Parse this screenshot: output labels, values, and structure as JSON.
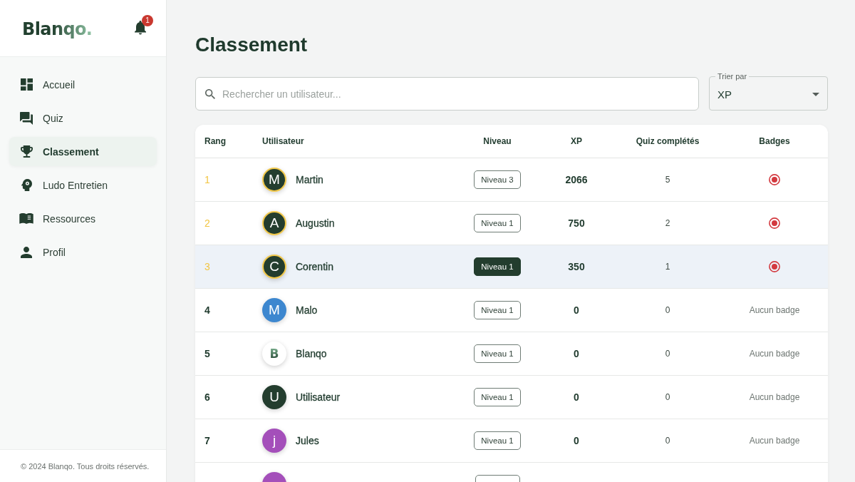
{
  "sidebar": {
    "logo": "Blanqo.",
    "notifications": {
      "count": "1"
    },
    "nav": [
      {
        "label": "Accueil",
        "selected": false
      },
      {
        "label": "Quiz",
        "selected": false
      },
      {
        "label": "Classement",
        "selected": true
      },
      {
        "label": "Ludo Entretien",
        "selected": false
      },
      {
        "label": "Ressources",
        "selected": false
      },
      {
        "label": "Profil",
        "selected": false
      }
    ],
    "footer": "© 2024 Blanqo. Tous droits réservés."
  },
  "page": {
    "title": "Classement"
  },
  "search": {
    "placeholder": "Rechercher un utilisateur..."
  },
  "sort": {
    "label": "Trier par",
    "value": "XP"
  },
  "table": {
    "columns": [
      "Rang",
      "Utilisateur",
      "Niveau",
      "XP",
      "Quiz complétés",
      "Badges"
    ],
    "rows": [
      {
        "kind": "full",
        "rank": "1",
        "podium": true,
        "current_user": false,
        "avatar": {
          "kind": "initial",
          "letter": "M",
          "color": "#233d2e"
        },
        "name": "Martin",
        "level": "Niveau 3",
        "xp": "2066",
        "quizzes": "5",
        "badge": {
          "kind": "icon"
        }
      },
      {
        "kind": "full",
        "rank": "2",
        "podium": true,
        "current_user": false,
        "avatar": {
          "kind": "initial",
          "letter": "A",
          "color": "#233d2e"
        },
        "name": "Augustin",
        "level": "Niveau 1",
        "xp": "750",
        "quizzes": "2",
        "badge": {
          "kind": "icon"
        }
      },
      {
        "kind": "full",
        "rank": "3",
        "podium": true,
        "current_user": true,
        "avatar": {
          "kind": "initial",
          "letter": "C",
          "color": "#233d2e"
        },
        "name": "Corentin",
        "level": "Niveau 1",
        "xp": "350",
        "quizzes": "1",
        "badge": {
          "kind": "icon"
        }
      },
      {
        "kind": "full",
        "rank": "4",
        "podium": false,
        "current_user": false,
        "avatar": {
          "kind": "initial",
          "letter": "M",
          "color": "#3d87cf"
        },
        "name": "Malo",
        "level": "Niveau 1",
        "xp": "0",
        "quizzes": "0",
        "badge": {
          "kind": "none",
          "label": "Aucun badge"
        }
      },
      {
        "kind": "full",
        "rank": "5",
        "podium": false,
        "current_user": false,
        "avatar": {
          "kind": "logo",
          "letter": "B",
          "color": "#ffffff"
        },
        "name": "Blanqo",
        "level": "Niveau 1",
        "xp": "0",
        "quizzes": "0",
        "badge": {
          "kind": "none",
          "label": "Aucun badge"
        }
      },
      {
        "kind": "full",
        "rank": "6",
        "podium": false,
        "current_user": false,
        "avatar": {
          "kind": "initial",
          "letter": "U",
          "color": "#233d2e"
        },
        "name": "Utilisateur",
        "level": "Niveau 1",
        "xp": "0",
        "quizzes": "0",
        "badge": {
          "kind": "none",
          "label": "Aucun badge"
        }
      },
      {
        "kind": "full",
        "rank": "7",
        "podium": false,
        "current_user": false,
        "avatar": {
          "kind": "initial",
          "letter": "j",
          "color": "#a44fba"
        },
        "name": "Jules",
        "level": "Niveau 1",
        "xp": "0",
        "quizzes": "0",
        "badge": {
          "kind": "none",
          "label": "Aucun badge"
        }
      },
      {
        "kind": "partial",
        "avatar": {
          "color": "#a44fba"
        }
      }
    ]
  }
}
